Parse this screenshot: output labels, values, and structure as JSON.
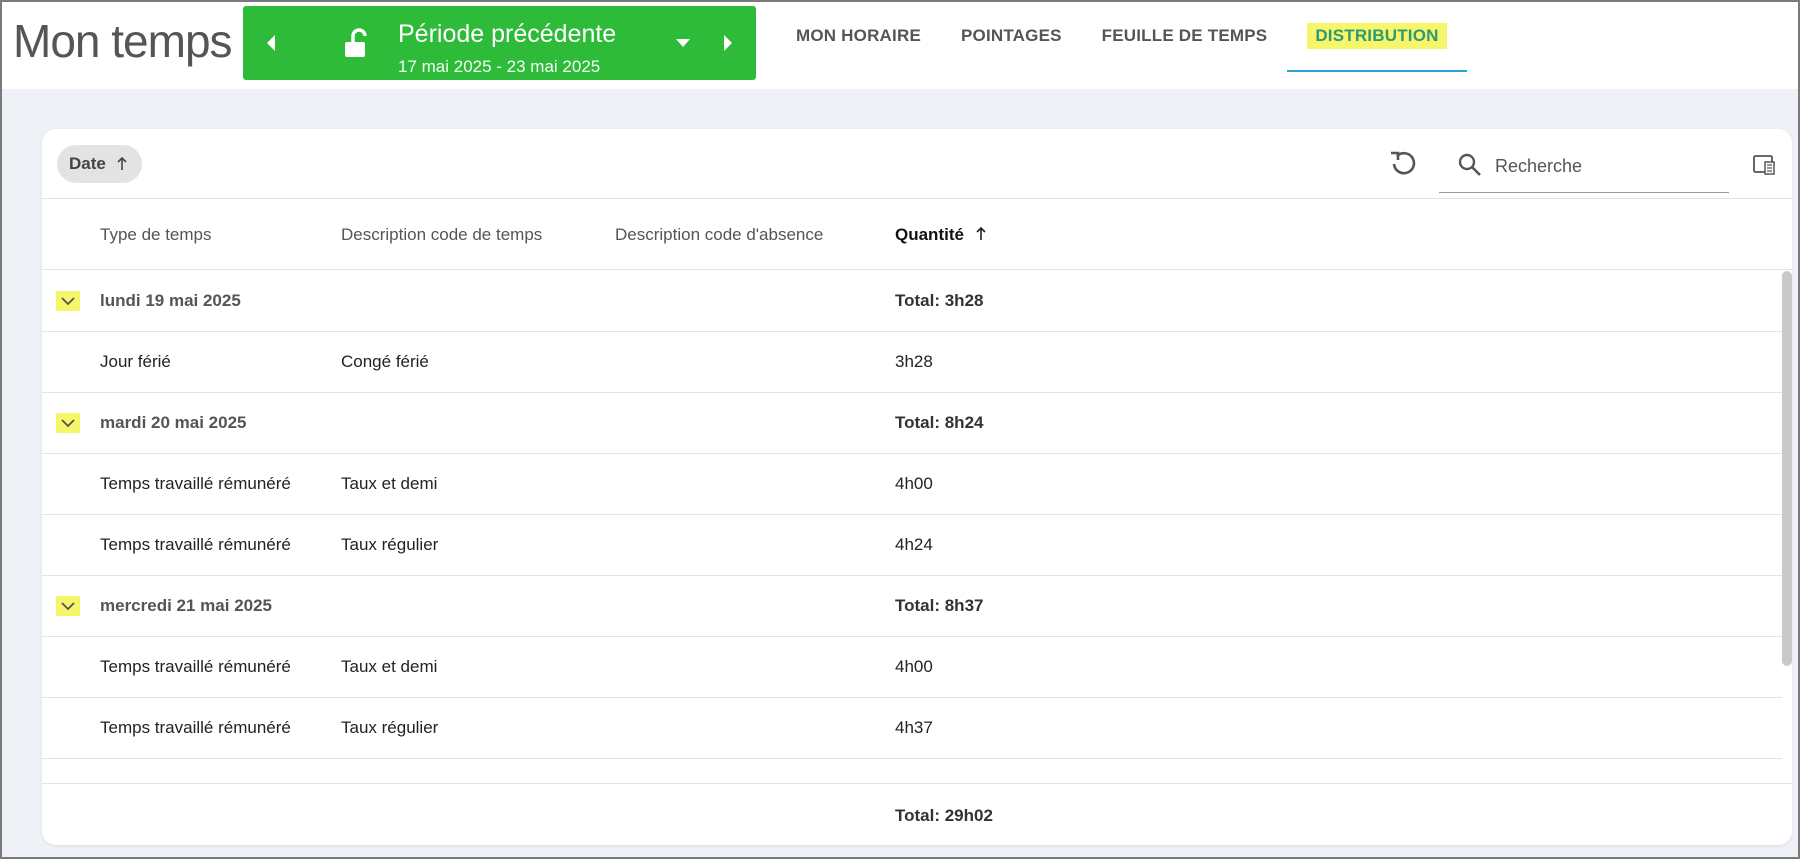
{
  "header": {
    "title": "Mon temps",
    "period": {
      "label": "Période précédente",
      "dates": "17 mai 2025 - 23 mai 2025"
    },
    "tabs": [
      {
        "label": "MON HORAIRE",
        "active": false
      },
      {
        "label": "POINTAGES",
        "active": false
      },
      {
        "label": "FEUILLE DE TEMPS",
        "active": false
      },
      {
        "label": "DISTRIBUTION",
        "active": true
      }
    ]
  },
  "toolbar": {
    "sort_chip": "Date",
    "search_placeholder": "Recherche"
  },
  "columns": [
    "Type de temps",
    "Description code de temps",
    "Description code d'absence",
    "Quantité"
  ],
  "rows": [
    {
      "kind": "group",
      "date": "lundi 19 mai 2025",
      "total": "Total: 3h28"
    },
    {
      "kind": "item",
      "type": "Jour férié",
      "code": "Congé férié",
      "absence": "",
      "qty": "3h28"
    },
    {
      "kind": "group",
      "date": "mardi 20 mai 2025",
      "total": "Total: 8h24"
    },
    {
      "kind": "item",
      "type": "Temps travaillé rémunéré",
      "code": "Taux et demi",
      "absence": "",
      "qty": "4h00"
    },
    {
      "kind": "item",
      "type": "Temps travaillé rémunéré",
      "code": "Taux régulier",
      "absence": "",
      "qty": "4h24"
    },
    {
      "kind": "group",
      "date": "mercredi 21 mai 2025",
      "total": "Total: 8h37"
    },
    {
      "kind": "item",
      "type": "Temps travaillé rémunéré",
      "code": "Taux et demi",
      "absence": "",
      "qty": "4h00"
    },
    {
      "kind": "item",
      "type": "Temps travaillé rémunéré",
      "code": "Taux régulier",
      "absence": "",
      "qty": "4h37"
    }
  ],
  "footer": {
    "grand_total": "Total: 29h02"
  },
  "colors": {
    "accent_green": "#2fbb3a",
    "tab_active_text": "#2e9a72",
    "highlight": "#f7f56a",
    "tab_underline": "#29a3d6"
  }
}
